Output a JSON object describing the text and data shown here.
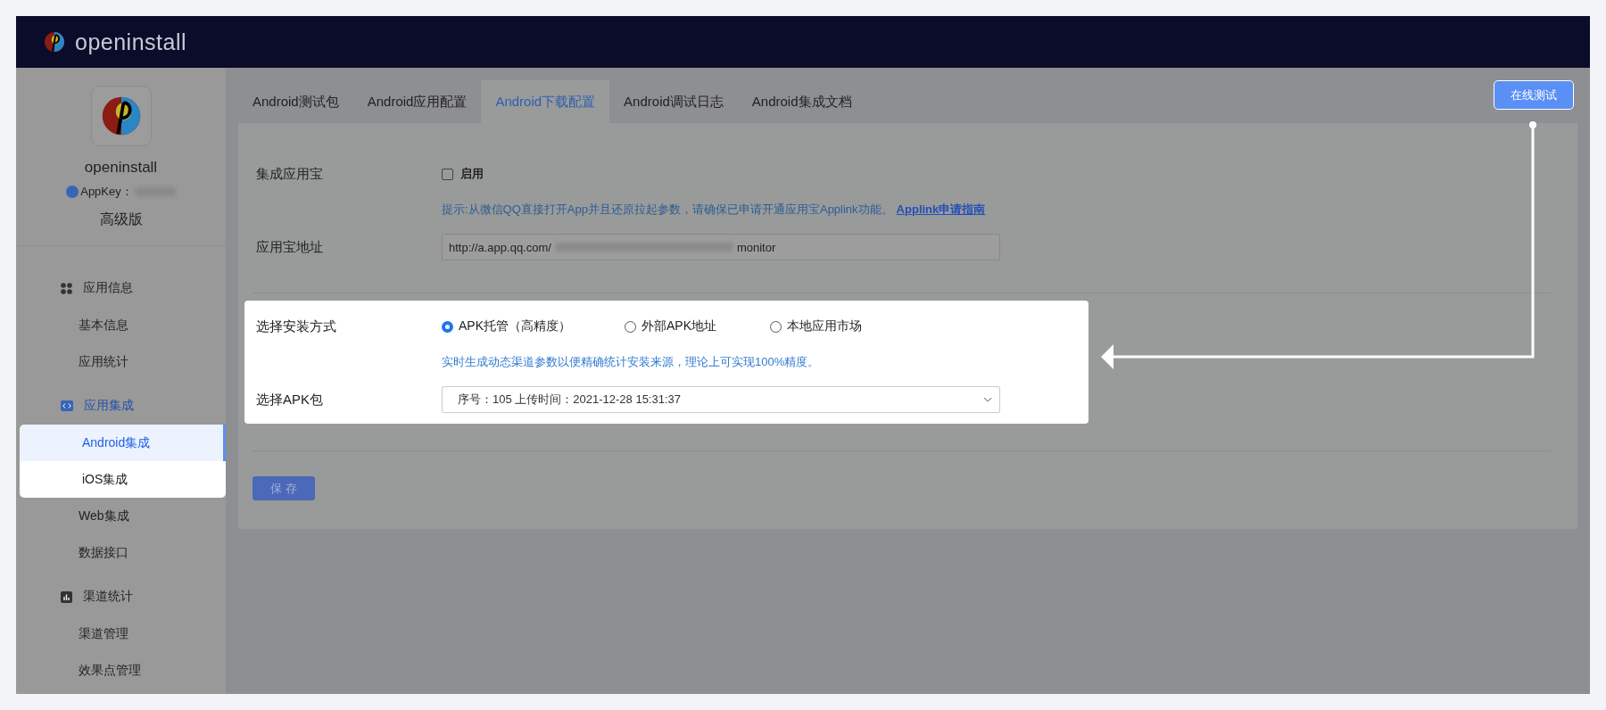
{
  "header": {
    "brand": "openinstall"
  },
  "sidebar": {
    "app_name": "openinstall",
    "appkey_label": "AppKey：",
    "plan": "高级版",
    "groups": [
      {
        "title": "应用信息",
        "kind": "grid",
        "selected": false,
        "items": [
          {
            "label": "基本信息",
            "selected": false,
            "highlighted": false
          },
          {
            "label": "应用统计",
            "selected": false,
            "highlighted": false
          }
        ]
      },
      {
        "title": "应用集成",
        "kind": "code",
        "selected": true,
        "items": [
          {
            "label": "Android集成",
            "selected": true,
            "highlighted": true
          },
          {
            "label": "iOS集成",
            "selected": false,
            "highlighted": true
          },
          {
            "label": "Web集成",
            "selected": false,
            "highlighted": false
          },
          {
            "label": "数据接口",
            "selected": false,
            "highlighted": false
          }
        ]
      },
      {
        "title": "渠道统计",
        "kind": "chart",
        "selected": false,
        "items": [
          {
            "label": "渠道管理",
            "selected": false,
            "highlighted": false
          },
          {
            "label": "效果点管理",
            "selected": false,
            "highlighted": false
          }
        ]
      }
    ]
  },
  "tabs": [
    {
      "label": "Android测试包",
      "selected": false
    },
    {
      "label": "Android应用配置",
      "selected": false
    },
    {
      "label": "Android下载配置",
      "selected": true
    },
    {
      "label": "Android调试日志",
      "selected": false
    },
    {
      "label": "Android集成文档",
      "selected": false
    }
  ],
  "test_button": "在线测试",
  "yyb": {
    "label": "集成应用宝",
    "checkbox": {
      "label": "启用",
      "checked": false
    },
    "hint": "提示:从微信QQ直接打开App并且还原拉起参数，请确保已申请开通应用宝Applink功能。",
    "link": "Applink申请指南",
    "url_label": "应用宝地址",
    "url_prefix": "http://a.app.qq.com/",
    "url_suffix": "monitor"
  },
  "install": {
    "highlighted": true,
    "label": "选择安装方式",
    "options": [
      {
        "label": "APK托管（高精度）",
        "selected": true
      },
      {
        "label": "外部APK地址",
        "selected": false
      },
      {
        "label": "本地应用市场",
        "selected": false
      }
    ],
    "hint": "实时生成动态渠道参数以便精确统计安装来源，理论上可实现100%精度。",
    "apk_label": "选择APK包",
    "apk_value": "序号：105 上传时间：2021-12-28 15:31:37"
  },
  "save_button": "保 存"
}
